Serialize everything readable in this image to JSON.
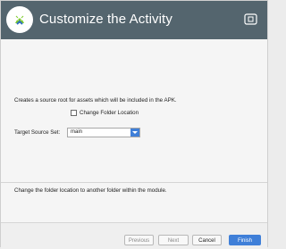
{
  "header": {
    "title": "Customize the Activity",
    "logo_icon": "android-studio-logo",
    "device_icon": "device-preview-icon"
  },
  "content": {
    "description": "Creates a source root for assets which will be included in the APK.",
    "change_folder_label": "Change Folder Location",
    "target_source_set_label": "Target Source Set:",
    "target_source_set_value": "main",
    "help_text": "Change the folder location to another folder within the module."
  },
  "footer": {
    "previous": "Previous",
    "next": "Next",
    "cancel": "Cancel",
    "finish": "Finish"
  },
  "colors": {
    "header_bg": "#54656e",
    "accent": "#3f7fd8"
  }
}
